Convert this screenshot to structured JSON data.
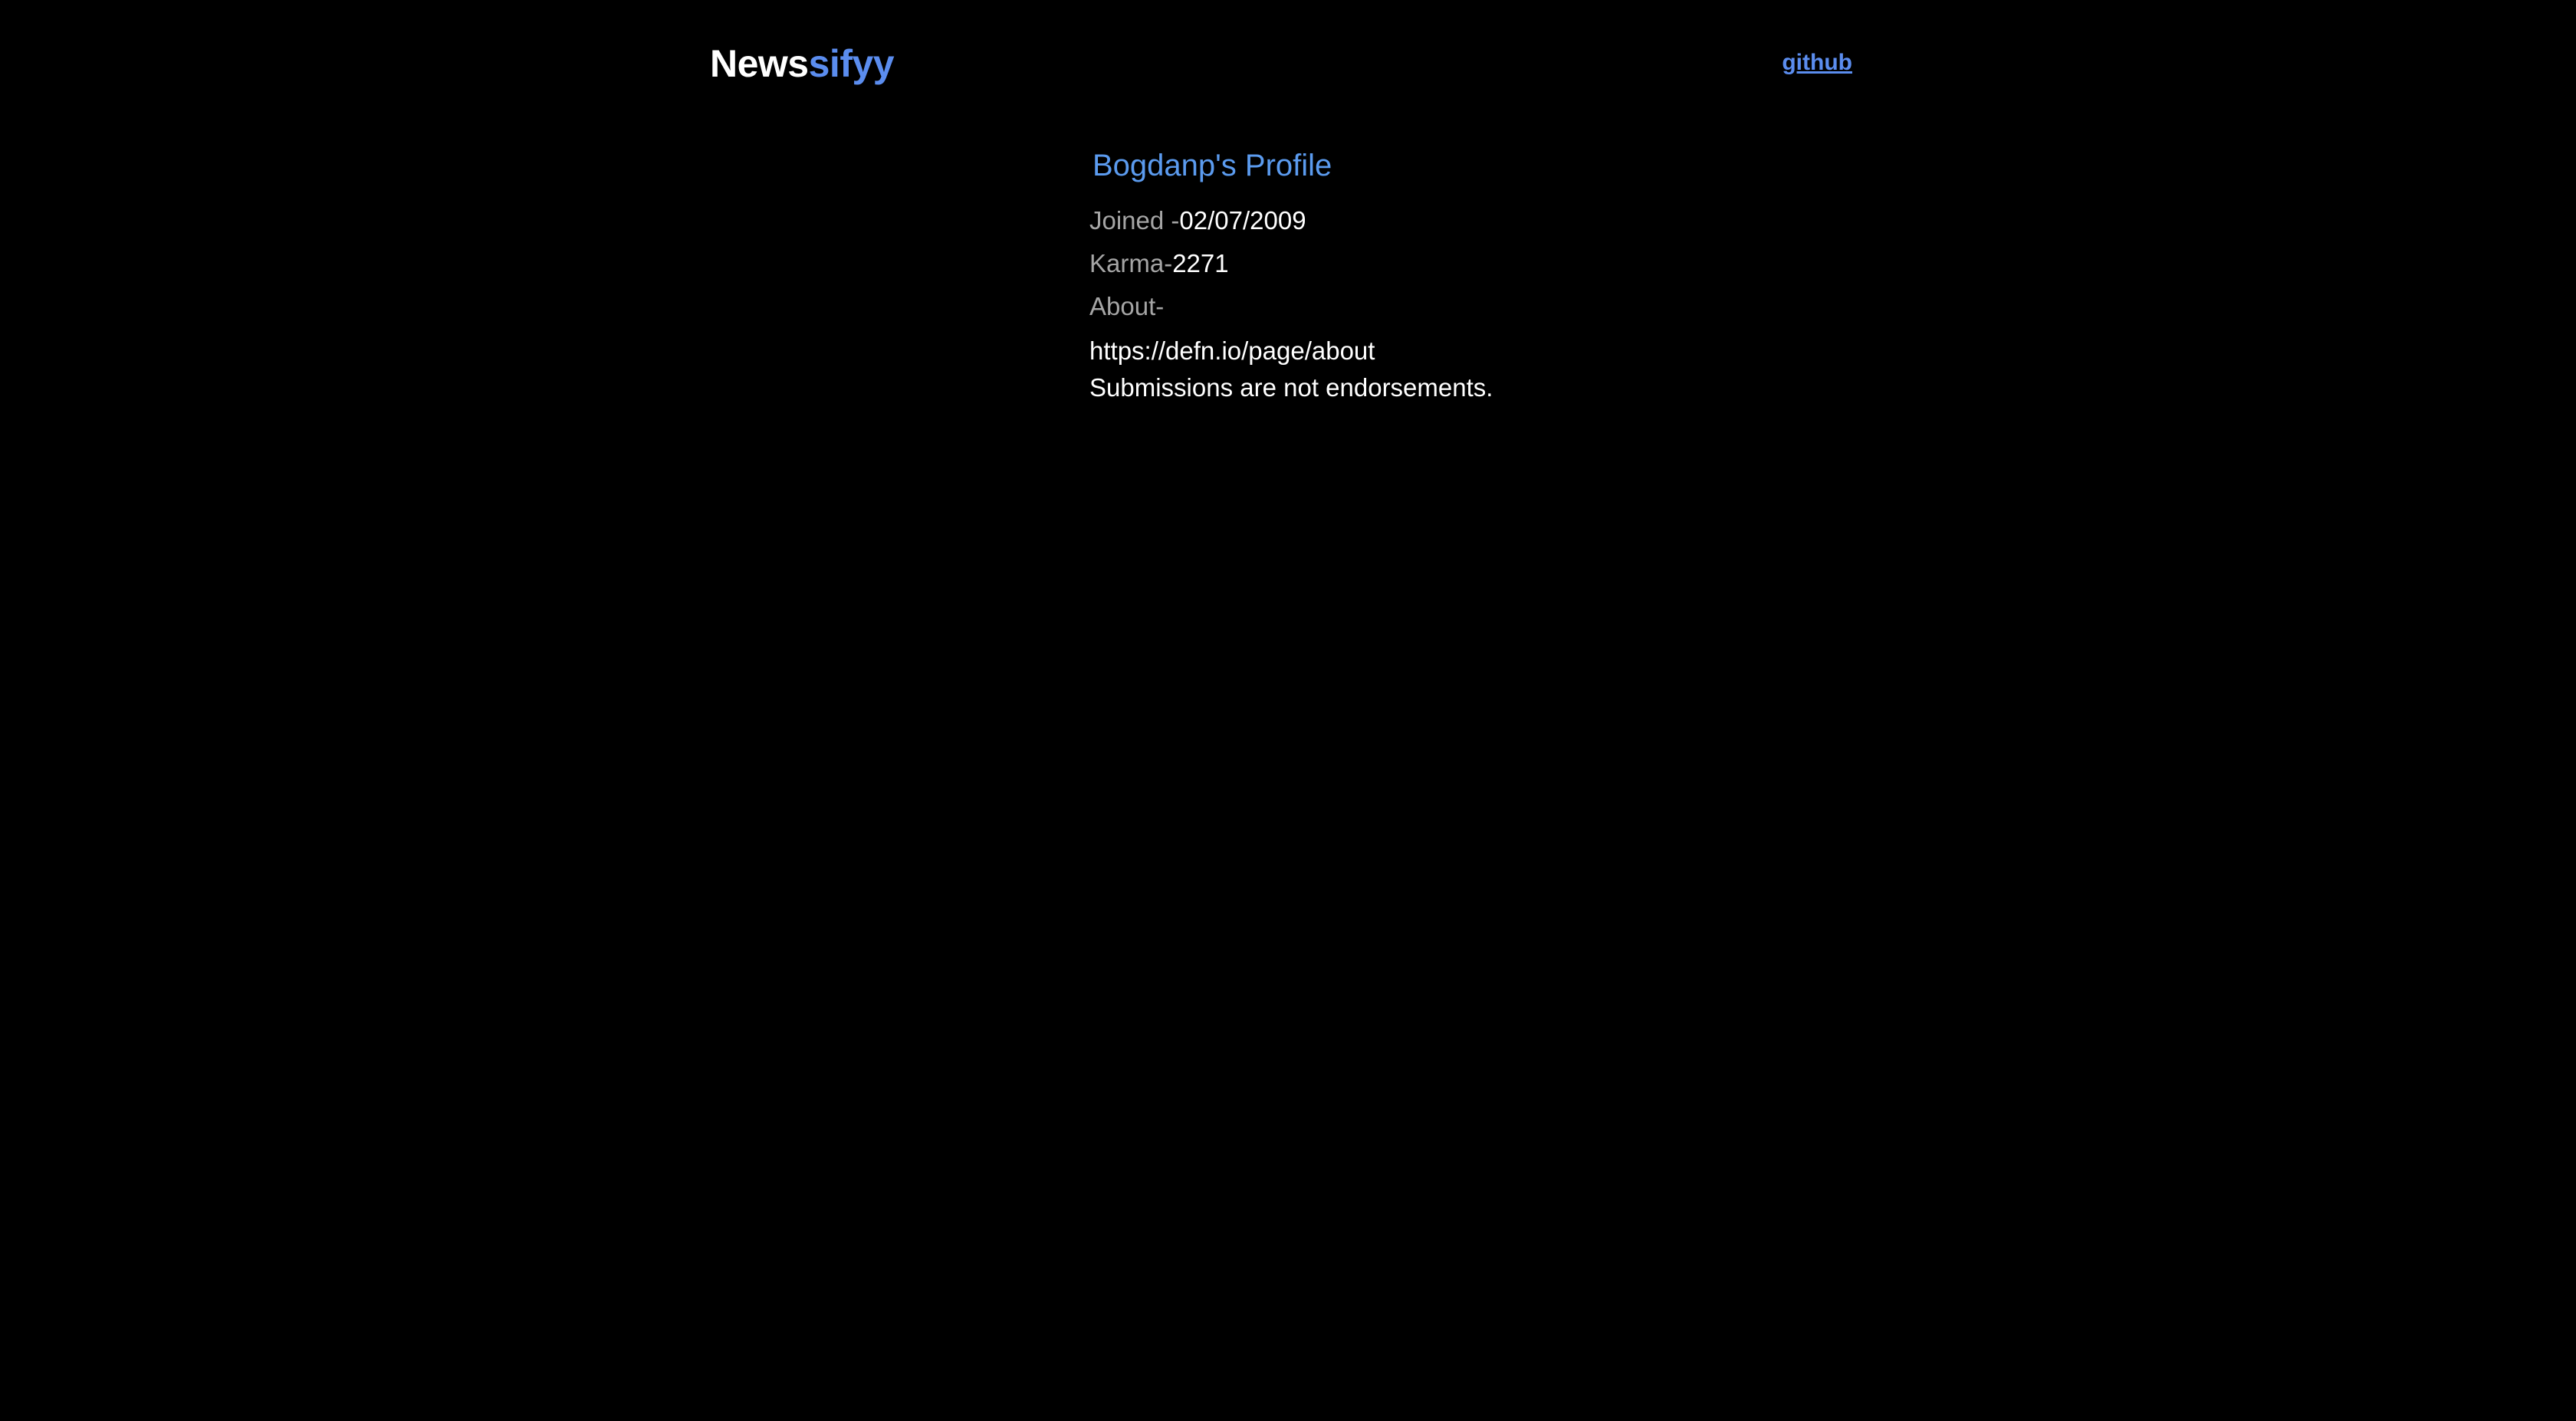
{
  "header": {
    "brand_part1": "News",
    "brand_part2": "sifyy",
    "github_label": "github"
  },
  "profile": {
    "title": "Bogdanp's Profile",
    "joined_label": "Joined -",
    "joined_value": "02/07/2009",
    "karma_label": "Karma-",
    "karma_value": "2271",
    "about_label": "About-",
    "about_lines": [
      "https://defn.io/page/about",
      "Submissions are not endorsements."
    ]
  },
  "colors": {
    "background": "#000000",
    "accent": "#5b8def",
    "label": "#a5a5a5",
    "text": "#ffffff"
  }
}
